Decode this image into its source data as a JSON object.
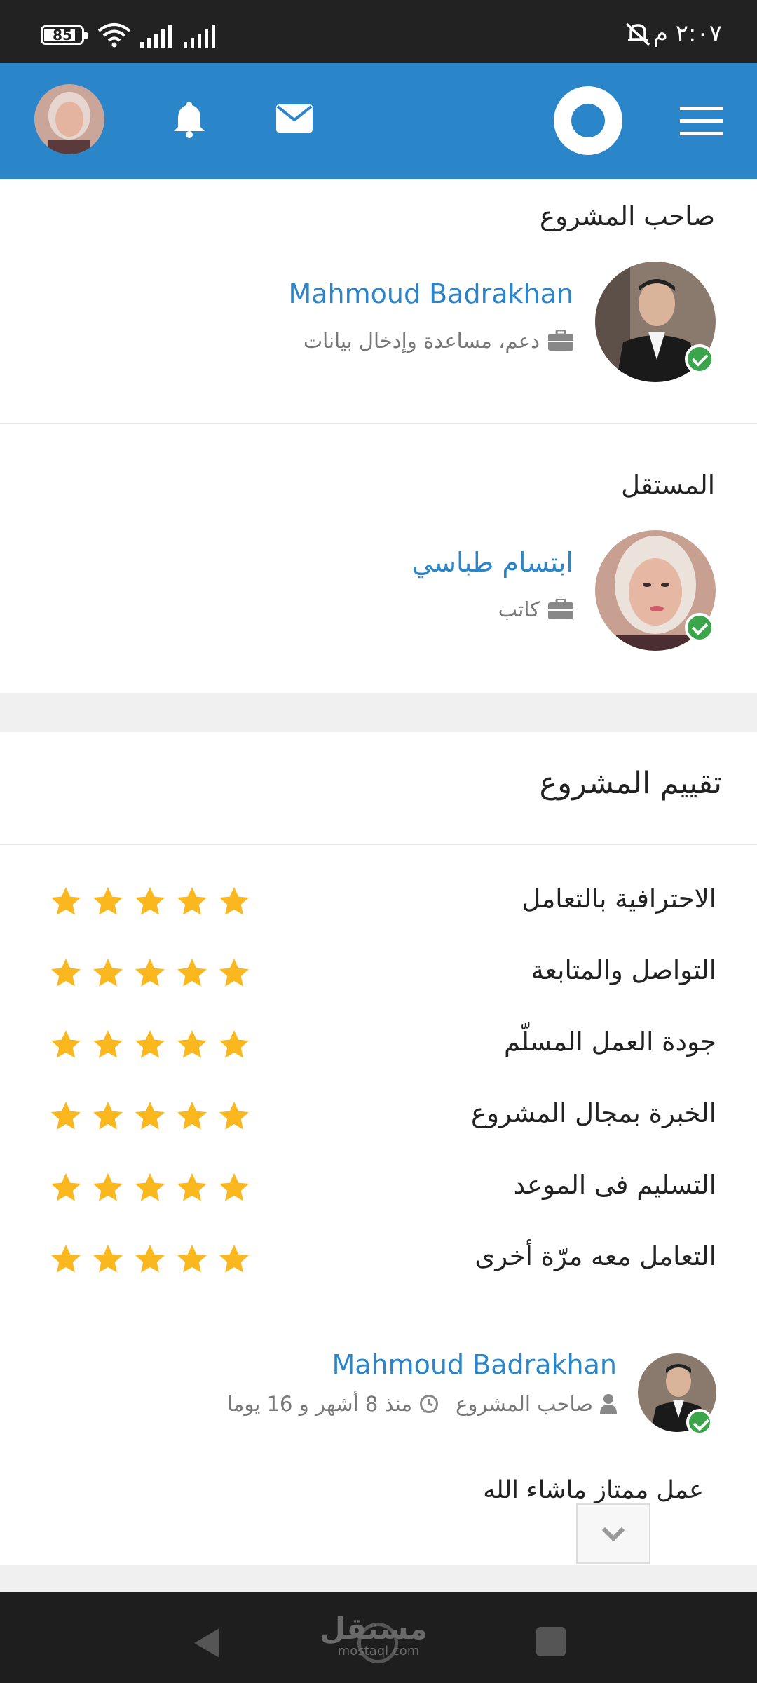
{
  "status_bar": {
    "battery": "85",
    "time": "٢:٠٧ م"
  },
  "top_bar": {
    "accent": "#2a86c9"
  },
  "owner_section": {
    "title": "صاحب المشروع",
    "name": "Mahmoud Badrakhan",
    "role": "دعم، مساعدة وإدخال بيانات"
  },
  "freelancer_section": {
    "title": "المستقل",
    "name": "ابتسام طباسي",
    "role": "كاتب"
  },
  "rating_section": {
    "title": "تقييم المشروع",
    "star_color": "#fbb81e",
    "rows": [
      {
        "label": "الاحترافية بالتعامل",
        "stars": 5
      },
      {
        "label": "التواصل والمتابعة",
        "stars": 5
      },
      {
        "label": "جودة العمل المسلّم",
        "stars": 5
      },
      {
        "label": "الخبرة بمجال المشروع",
        "stars": 5
      },
      {
        "label": "التسليم فى الموعد",
        "stars": 5
      },
      {
        "label": "التعامل معه مرّة أخرى",
        "stars": 5
      }
    ]
  },
  "review": {
    "name": "Mahmoud Badrakhan",
    "role": "صاحب المشروع",
    "time": "منذ 8 أشهر و 16 يوما",
    "text": "عمل ممتاز ماشاء الله"
  },
  "watermark": {
    "arabic": "مستقل",
    "latin": "mostaql.com"
  }
}
